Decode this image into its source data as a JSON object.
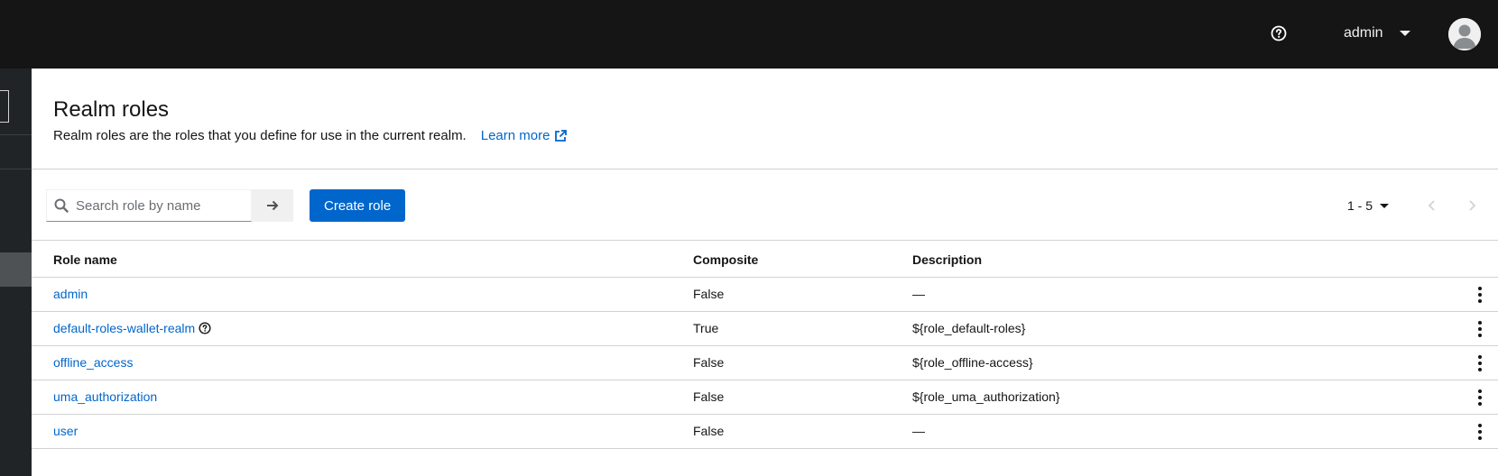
{
  "masthead": {
    "help_icon": "help-circle-icon",
    "username": "admin",
    "avatar_icon": "user-avatar-icon"
  },
  "page": {
    "title": "Realm roles",
    "description": "Realm roles are the roles that you define for use in the current realm.",
    "learn_more": "Learn more",
    "learn_more_icon": "external-link-icon"
  },
  "toolbar": {
    "search_placeholder": "Search role by name",
    "search_value": "",
    "create_label": "Create role",
    "pagination_label": "1 - 5"
  },
  "table": {
    "headers": [
      "Role name",
      "Composite",
      "Description"
    ],
    "rows": [
      {
        "name": "admin",
        "composite": "False",
        "description": "—",
        "has_help": false
      },
      {
        "name": "default-roles-wallet-realm",
        "composite": "True",
        "description": "${role_default-roles}",
        "has_help": true
      },
      {
        "name": "offline_access",
        "composite": "False",
        "description": "${role_offline-access}",
        "has_help": false
      },
      {
        "name": "uma_authorization",
        "composite": "False",
        "description": "${role_uma_authorization}",
        "has_help": false
      },
      {
        "name": "user",
        "composite": "False",
        "description": "—",
        "has_help": false
      }
    ]
  },
  "colors": {
    "masthead_bg": "#151515",
    "sidebar_bg": "#212427",
    "link": "#0066cc",
    "primary_button": "#0066cc",
    "border": "#d2d2d2"
  }
}
